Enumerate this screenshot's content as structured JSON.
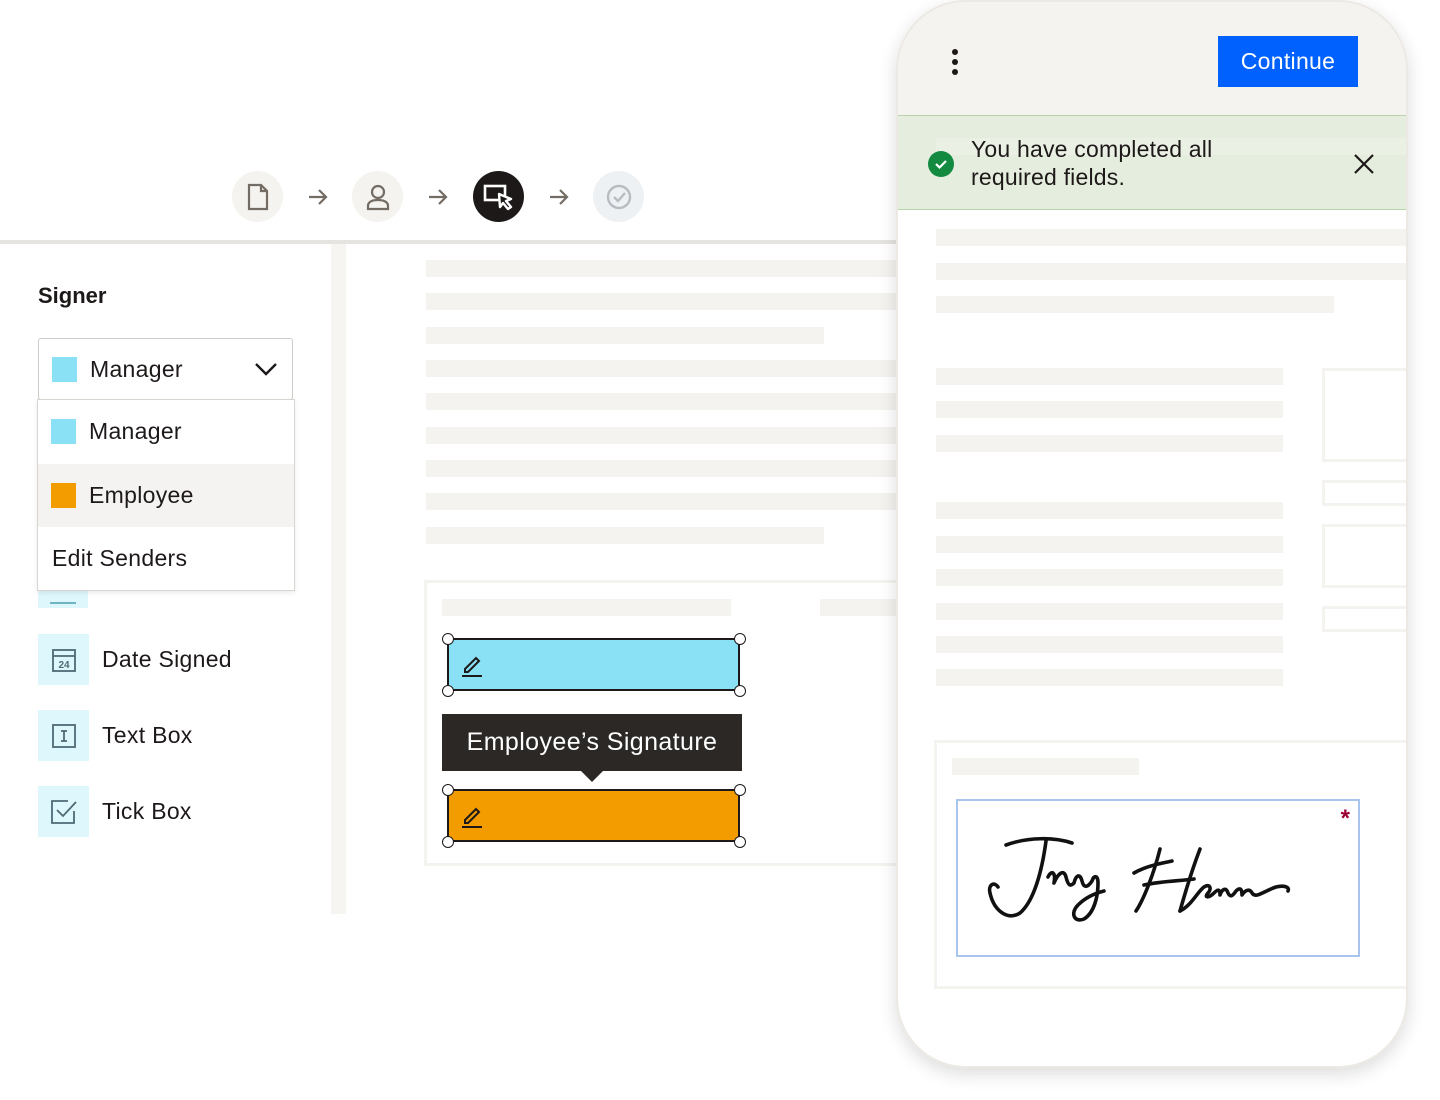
{
  "stepper": {
    "steps": [
      {
        "name": "document",
        "icon": "document-icon",
        "state": "default"
      },
      {
        "name": "recipients",
        "icon": "person-icon",
        "state": "default"
      },
      {
        "name": "fields",
        "icon": "cursor-select-icon",
        "state": "active"
      },
      {
        "name": "review",
        "icon": "check-circle-icon",
        "state": "inactive"
      }
    ]
  },
  "sidebar": {
    "signer_label": "Signer",
    "selected_signer": "Manager",
    "dropdown": {
      "items": [
        {
          "label": "Manager",
          "color": "#8ae1f6"
        },
        {
          "label": "Employee",
          "color": "#f29c00"
        }
      ],
      "edit_label": "Edit Senders"
    },
    "field_types": [
      {
        "label": "Date Signed",
        "icon": "calendar-icon"
      },
      {
        "label": "Text Box",
        "icon": "text-box-icon"
      },
      {
        "label": "Tick Box",
        "icon": "checkbox-icon"
      }
    ]
  },
  "editor": {
    "tooltip": "Employee’s Signature",
    "fields": [
      {
        "signer": "Manager",
        "color": "#8ae1f6",
        "icon": "pen-icon"
      },
      {
        "signer": "Employee",
        "color": "#f29c00",
        "icon": "pen-icon"
      }
    ]
  },
  "phone": {
    "continue_label": "Continue",
    "banner_text": "You have completed all required fields.",
    "signature_required_marker": "*"
  },
  "colors": {
    "accent": "#0061fe",
    "manager": "#8ae1f6",
    "employee": "#f29c00",
    "success": "#128a40",
    "required": "#9b0032"
  }
}
